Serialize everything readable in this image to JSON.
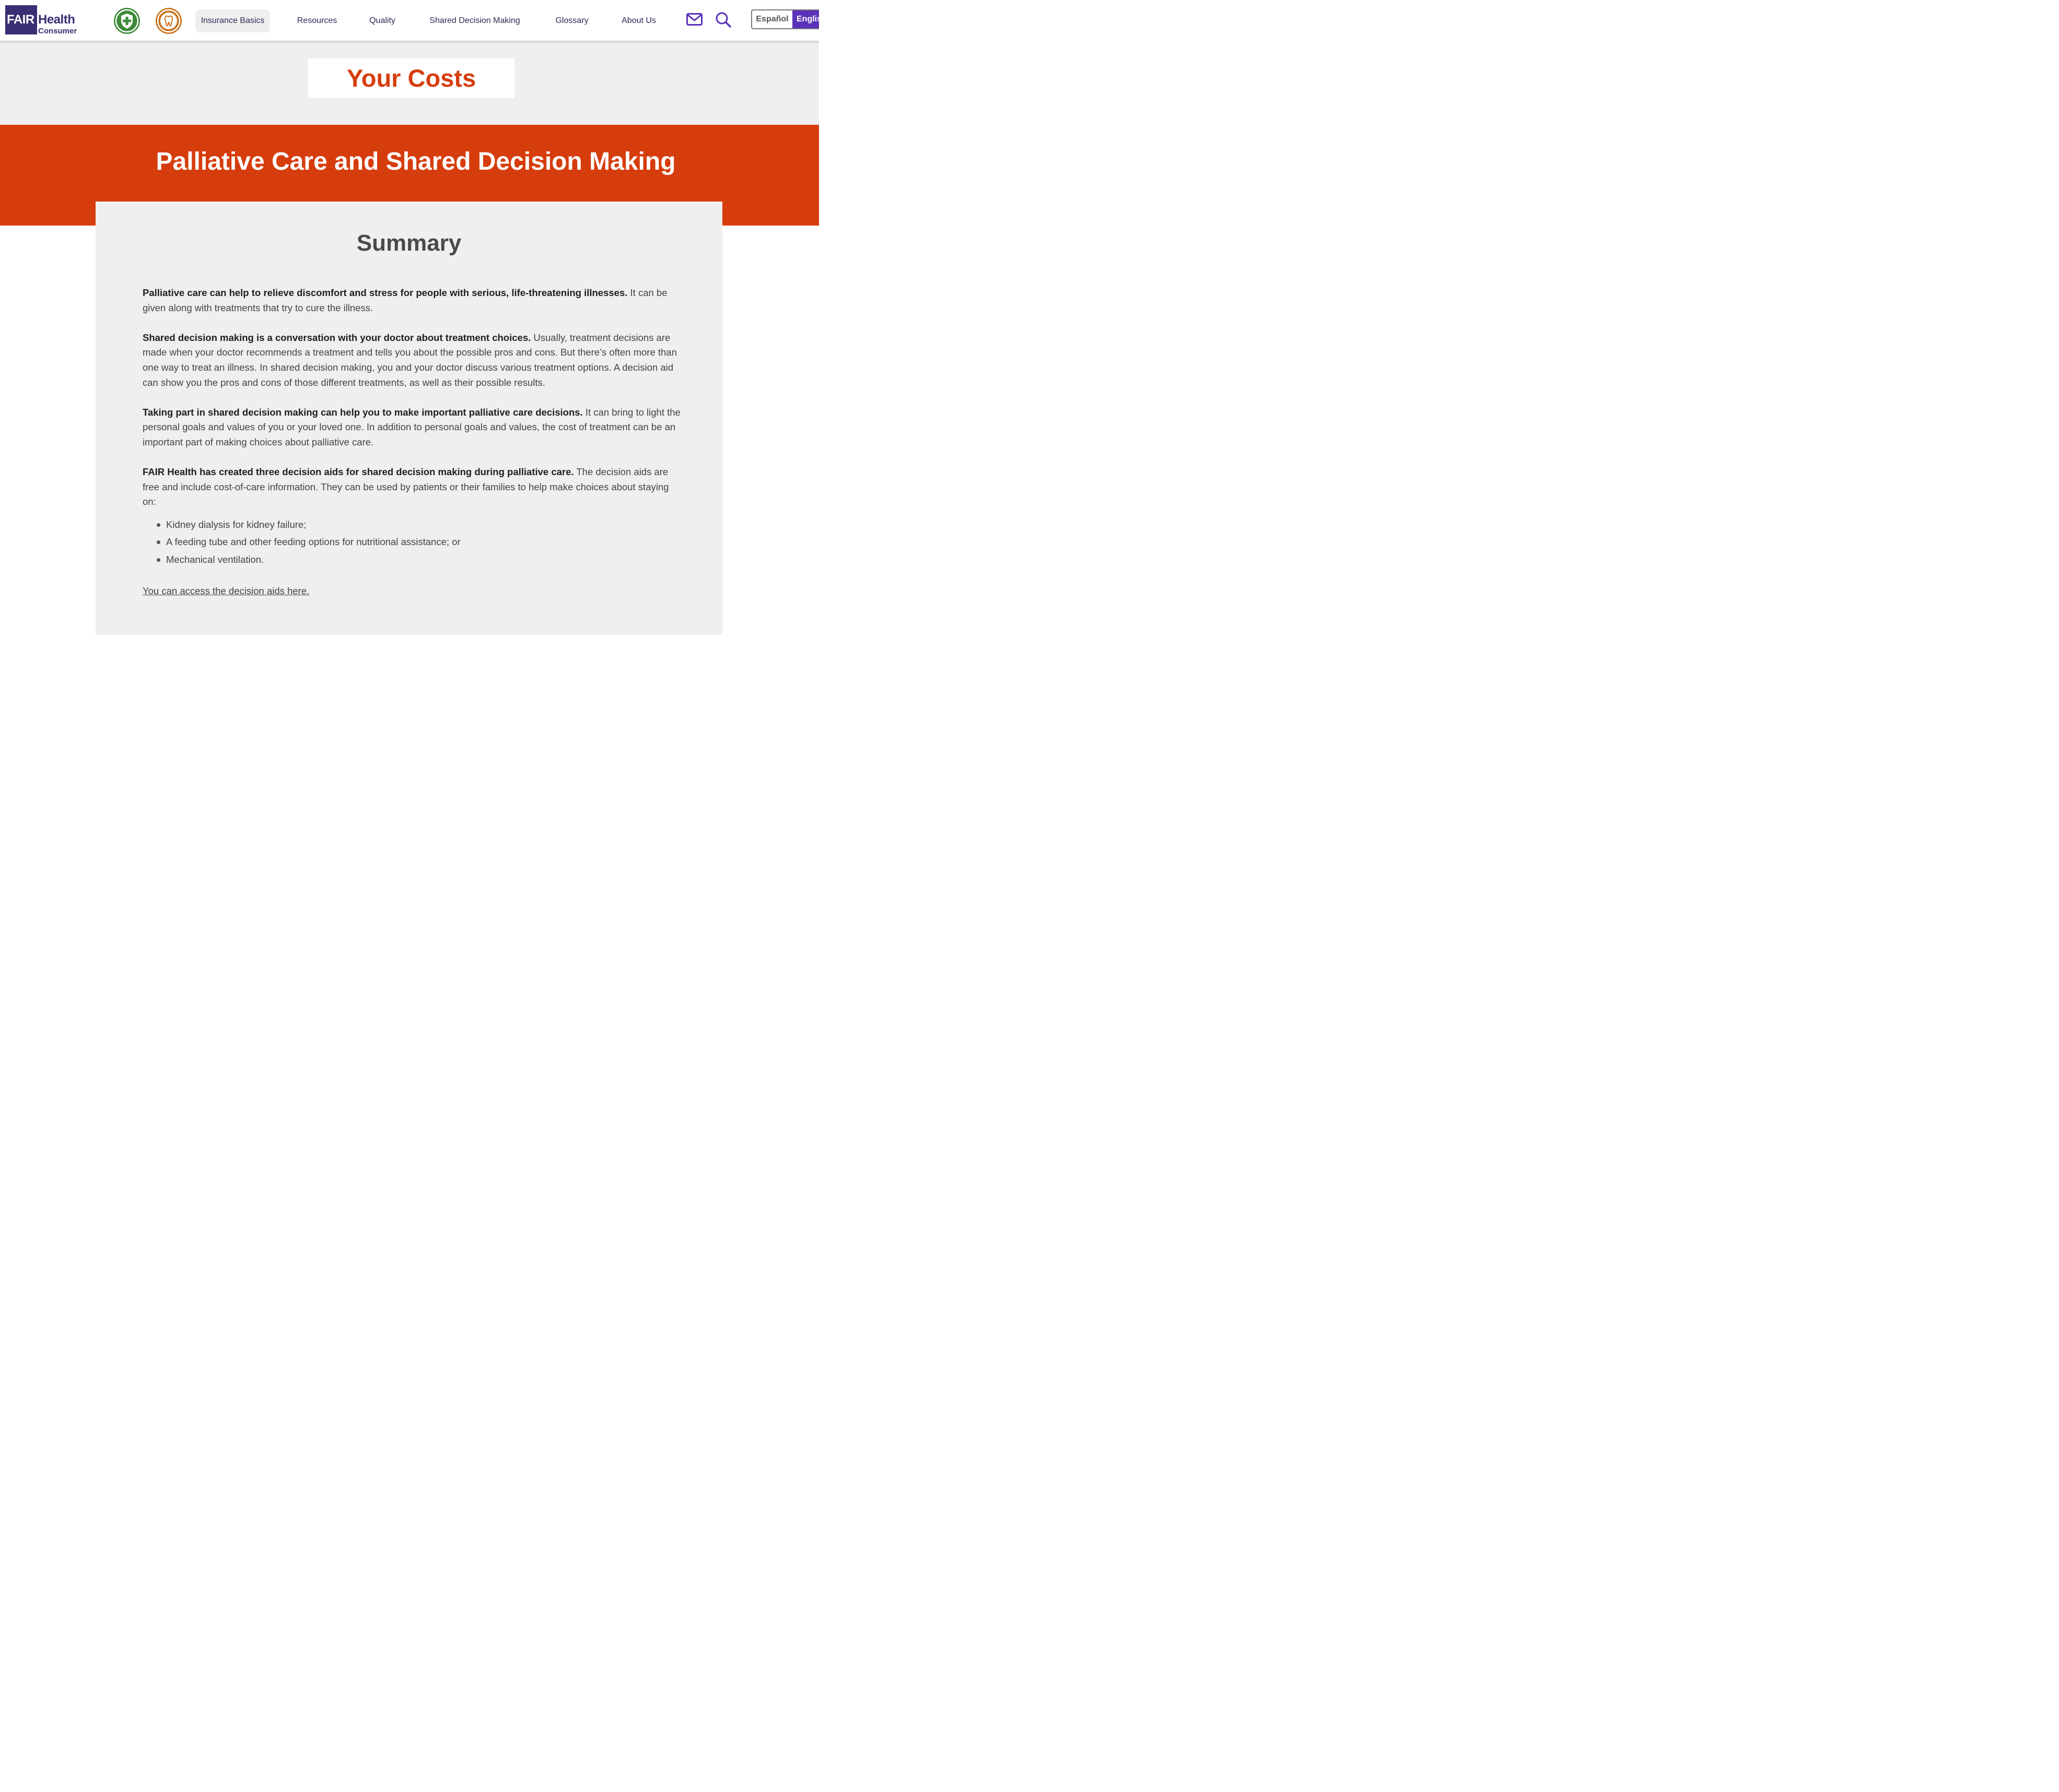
{
  "header": {
    "logo": {
      "fair": "FAIR",
      "health": "Health",
      "consumer": "Consumer"
    },
    "icons": [
      "medical-shield-icon",
      "dental-tooth-icon",
      "mail-icon",
      "search-icon"
    ],
    "nav": [
      {
        "label": "Insurance Basics",
        "active": true
      },
      {
        "label": "Resources",
        "active": false
      },
      {
        "label": "Quality",
        "active": false
      },
      {
        "label": "Shared Decision Making",
        "active": false
      },
      {
        "label": "Glossary",
        "active": false
      },
      {
        "label": "About Us",
        "active": false
      }
    ],
    "language": {
      "spanish": "Español",
      "english": "English",
      "selected": "English"
    }
  },
  "section_label": "Your Costs",
  "page_title": "Palliative Care and Shared Decision Making",
  "summary": {
    "heading": "Summary",
    "paragraphs": [
      {
        "bold": "Palliative care can help to relieve discomfort and stress for people with serious, life-threatening illnesses.",
        "text": " It can be given along with treatments that try to cure the illness."
      },
      {
        "bold": "Shared decision making is a conversation with your doctor about treatment choices.",
        "text": " Usually, treatment decisions are made when your doctor recommends a treatment and tells you about the possible pros and cons. But there’s often more than one way to treat an illness. In shared decision making, you and your doctor discuss various treatment options. A decision aid can show you the pros and cons of those different treatments, as well as their possible results."
      },
      {
        "bold": "Taking part in shared decision making can help you to make important palliative care decisions.",
        "text": " It can bring to light the personal goals and values of you or your loved one. In addition to personal goals and values, the cost of treatment can be an important part of making choices about palliative care."
      },
      {
        "bold": "FAIR Health has created three decision aids for shared decision making during palliative care.",
        "text": " The decision aids are free and include cost-of-care information. They can be used by patients or their families to help make choices about staying on:"
      }
    ],
    "bullets": [
      "Kidney dialysis for kidney failure;",
      "A feeding tube and other feeding options for nutritional assistance; or",
      "Mechanical ventilation."
    ],
    "link": "You can access the decision aids here."
  },
  "colors": {
    "brand_purple": "#3b2e73",
    "accent_orange": "#d63d0c",
    "icon_purple": "#5a31b8",
    "medical_green": "#3e8a3a",
    "dental_orange": "#c9741e"
  }
}
